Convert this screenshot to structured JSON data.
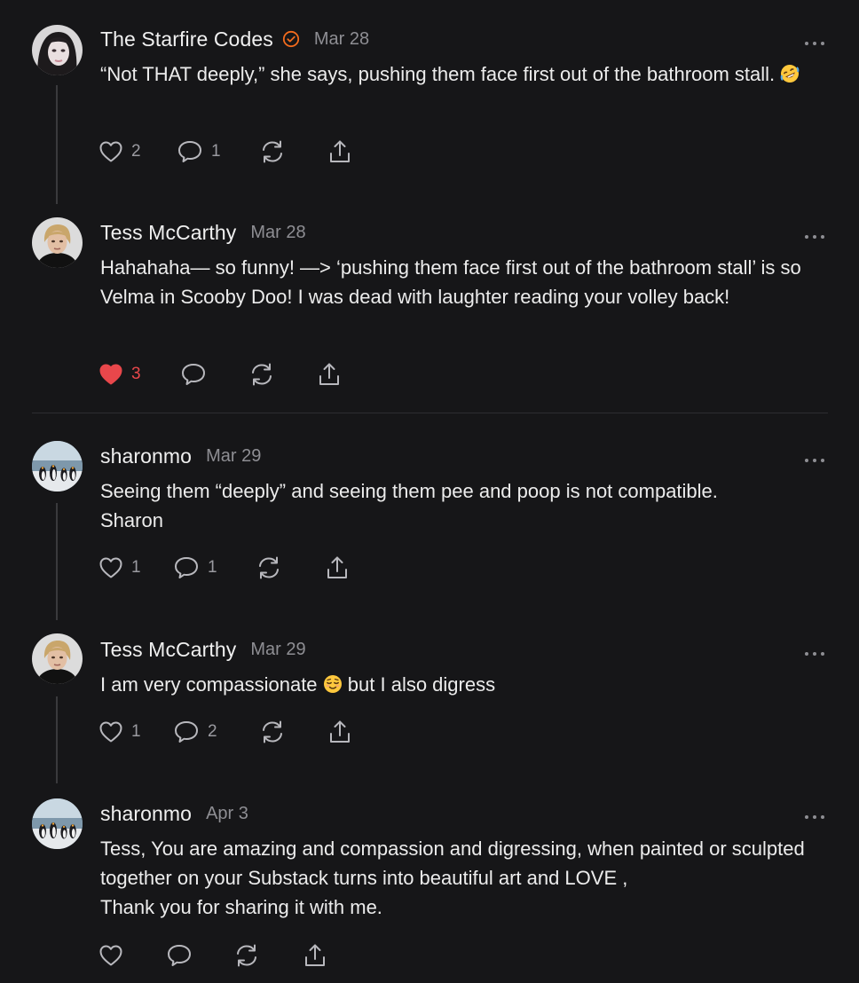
{
  "comments": [
    {
      "author": "The Starfire Codes",
      "verified": true,
      "date": "Mar 28",
      "text_before_emoji": "“Not THAT deeply,” she says, pushing them face first out of the bathroom stall. ",
      "emoji": "rofl",
      "text_after_emoji": "",
      "likes": "2",
      "replies": "1",
      "liked": false,
      "avatar": "woman-dark-hair"
    },
    {
      "author": "Tess McCarthy",
      "verified": false,
      "date": "Mar 28",
      "text_before_emoji": "Hahahaha— so funny! —> ‘pushing them face first out of the bathroom stall’ is so Velma in Scooby Doo! I was dead with laughter reading your volley back!",
      "emoji": "",
      "text_after_emoji": "",
      "likes": "3",
      "replies": "",
      "liked": true,
      "avatar": "woman-blonde"
    },
    {
      "author": "sharonmo",
      "verified": false,
      "date": "Mar 29",
      "text_before_emoji": "Seeing them “deeply” and seeing them pee and poop is not compatible.\nSharon",
      "emoji": "",
      "text_after_emoji": "",
      "likes": "1",
      "replies": "1",
      "liked": false,
      "avatar": "penguins"
    },
    {
      "author": "Tess McCarthy",
      "verified": false,
      "date": "Mar 29",
      "text_before_emoji": "I am very compassionate ",
      "emoji": "relieved",
      "text_after_emoji": " but I also digress",
      "likes": "1",
      "replies": "2",
      "liked": false,
      "avatar": "woman-blonde"
    },
    {
      "author": "sharonmo",
      "verified": false,
      "date": "Apr 3",
      "text_before_emoji": "Tess, You are amazing and compassion and digressing, when painted or sculpted together on your Substack turns into beautiful art and LOVE ,\nThank you for sharing it with me.",
      "emoji": "",
      "text_after_emoji": "",
      "likes": "",
      "replies": "",
      "liked": false,
      "avatar": "penguins"
    }
  ],
  "colors": {
    "background": "#161618",
    "text": "#ECECEC",
    "muted": "#8E8E93",
    "like_active": "#E8474B",
    "verified": "#F26B1D"
  },
  "icons": [
    "heart-icon",
    "comment-icon",
    "restack-icon",
    "share-icon",
    "more-options-icon",
    "verified-badge-icon"
  ]
}
